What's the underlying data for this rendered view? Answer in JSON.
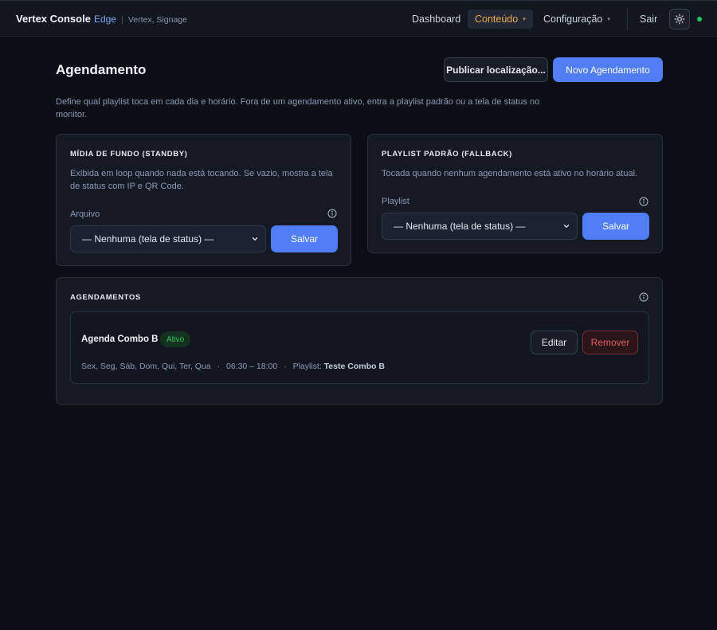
{
  "brand": {
    "title": "Vertex Console",
    "edge": "Edge",
    "separator": "|",
    "subtitle": "Vertex, Signage"
  },
  "nav": {
    "dashboard": "Dashboard",
    "conteudo": "Conteúdo",
    "configuracao": "Configuração",
    "sair": "Sair",
    "caret": "▾"
  },
  "page": {
    "title": "Agendamento",
    "publish_label": "Publicar localização...",
    "new_label": "Novo Agendamento",
    "description": "Define qual playlist toca em cada dia e horário. Fora de um agendamento ativo, entra a playlist padrão ou a tela de status no monitor."
  },
  "standby": {
    "heading": "MÍDIA DE FUNDO (STANDBY)",
    "description": "Exibida em loop quando nada está tocando. Se vazio, mostra a tela de status com IP e QR Code.",
    "field_label": "Arquivo",
    "selected": "— Nenhuma (tela de status) —",
    "save_label": "Salvar"
  },
  "fallback": {
    "heading": "PLAYLIST PADRÃO (FALLBACK)",
    "description": "Tocada quando nenhum agendamento está ativo no horário atual.",
    "field_label": "Playlist",
    "selected": "— Nenhuma (tela de status) —",
    "save_label": "Salvar"
  },
  "schedules": {
    "heading": "AGENDAMENTOS",
    "items": [
      {
        "name": "Agenda Combo B",
        "status": "Ativo",
        "days": "Sex, Seg, Sáb, Dom, Qui, Ter, Qua",
        "dot1": "·",
        "time": "06:30 – 18:00",
        "dot2": "·",
        "playlist_label": "Playlist:",
        "playlist": "Teste Combo B",
        "edit_label": "Editar",
        "remove_label": "Remover"
      }
    ]
  },
  "colors": {
    "accent": "#4f7ef7",
    "active_nav": "#f0a94a",
    "status_online": "#22c55e",
    "danger": "#e25c63"
  },
  "icons": [
    "sun-icon",
    "info-icon",
    "chevron-down-icon"
  ]
}
